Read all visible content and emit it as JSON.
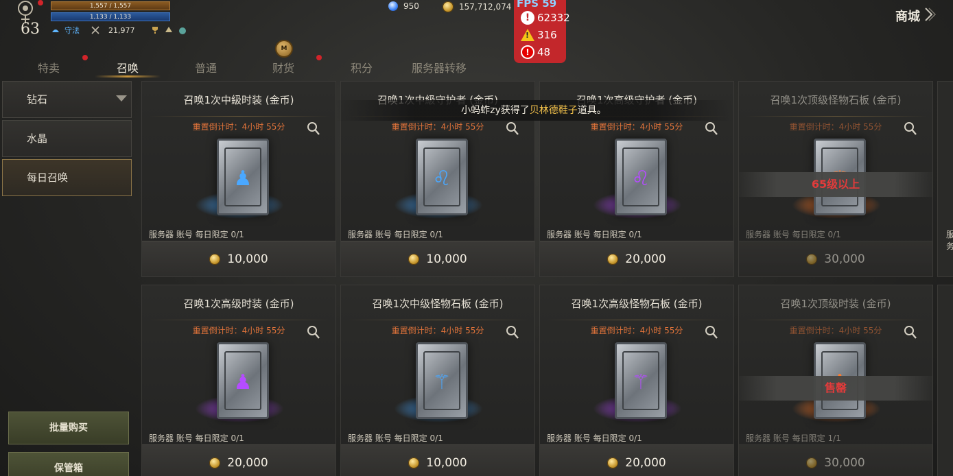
{
  "player": {
    "level": "63",
    "hp": "1,557 / 1,557",
    "mp": "1,133 / 1,133",
    "stance": "守法",
    "combat_power": "21,977"
  },
  "currency": {
    "gems": "950",
    "gold": "157,712,074"
  },
  "debug": {
    "fps": "FPS 59",
    "info_count": "62332",
    "warning_count": "316",
    "error_count": "48"
  },
  "shop_title": "商城",
  "tabs": [
    {
      "label": "特卖"
    },
    {
      "label": "召唤"
    },
    {
      "label": "普通"
    },
    {
      "label": "财货"
    },
    {
      "label": "积分"
    },
    {
      "label": "服务器转移"
    }
  ],
  "medal_label": "M",
  "sidebar": {
    "items": [
      {
        "label": "钻石"
      },
      {
        "label": "水晶"
      },
      {
        "label": "每日召唤"
      }
    ],
    "bulk_buy": "批量购买",
    "storage": "保管箱"
  },
  "notice": {
    "before": "小蚂蚱zy获得了",
    "item": "贝林德鞋子",
    "after": "道具。"
  },
  "cards": [
    {
      "title": "召唤1次中級时装 (金币)",
      "timer": "重置倒计时：4小时 55分",
      "limit": "服务器 账号 每日限定 0/1",
      "price": "10,000",
      "glow": "#4aa8ff",
      "symbol": "hooded-figure",
      "overlay": ""
    },
    {
      "title": "召唤1次中級守护者 (金币)",
      "timer": "重置倒计时：4小时 55分",
      "limit": "服务器 账号 每日限定 0/1",
      "price": "10,000",
      "glow": "#4aa8ff",
      "symbol": "lion",
      "overlay": ""
    },
    {
      "title": "召唤1次高级守护者 (金币)",
      "timer": "重置倒计时：4小时 55分",
      "limit": "服务器 账号 每日限定 0/1",
      "price": "20,000",
      "glow": "#b54cff",
      "symbol": "lion",
      "overlay": ""
    },
    {
      "title": "召唤1次顶级怪物石板 (金币)",
      "timer": "重置倒计时：4小时 55分",
      "limit": "服务器 账号 每日限定 0/1",
      "price": "30,000",
      "glow": "#ff7a2a",
      "symbol": "monster-rune",
      "overlay": "65级以上"
    },
    {
      "title": "召唤1次高级时装 (金币)",
      "timer": "重置倒计时：4小时 55分",
      "limit": "服务器 账号 每日限定 0/1",
      "price": "20,000",
      "glow": "#b54cff",
      "symbol": "hooded-figure",
      "overlay": ""
    },
    {
      "title": "召唤1次中级怪物石板 (金币)",
      "timer": "重置倒计时：4小时 55分",
      "limit": "服务器 账号 每日限定 0/1",
      "price": "10,000",
      "glow": "#4aa8ff",
      "symbol": "monster-rune",
      "overlay": ""
    },
    {
      "title": "召唤1次高级怪物石板 (金币)",
      "timer": "重置倒计时：4小时 55分",
      "limit": "服务器 账号 每日限定 0/1",
      "price": "20,000",
      "glow": "#b54cff",
      "symbol": "monster-rune",
      "overlay": ""
    },
    {
      "title": "召唤1次顶级时装 (金币)",
      "timer": "重置倒计时：4小时 55分",
      "limit": "服务器 账号 每日限定 1/1",
      "price": "30,000",
      "glow": "#ff7a2a",
      "symbol": "hooded-figure",
      "overlay": "售罄"
    }
  ],
  "partial_card_limit": "服务"
}
